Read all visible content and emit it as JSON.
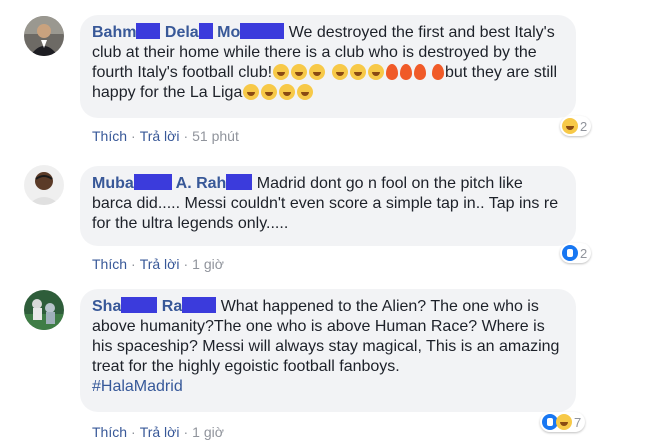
{
  "comments": [
    {
      "name_parts": [
        "Bahm",
        "Dela",
        "Mo"
      ],
      "text": "We destroyed the first and best Italy's club at their home while there is a club who is destroyed by the fourth Italy's football club!",
      "text_end": "but they are still happy for the La Liga",
      "actions": {
        "like": "Thích",
        "reply": "Trả lời",
        "time": "51 phút"
      },
      "reaction_count": "2",
      "reaction_icons": [
        "haha-icon"
      ]
    },
    {
      "name_parts": [
        "Muba",
        "A. Rah"
      ],
      "text": "Madrid dont go n fool on the pitch like barca did..... Messi couldn't even score a simple tap in.. Tap ins re for the ultra legends only.....",
      "actions": {
        "like": "Thích",
        "reply": "Trả lời",
        "time": "1 giờ"
      },
      "reaction_count": "2",
      "reaction_icons": [
        "like-icon"
      ]
    },
    {
      "name_parts": [
        "Sha",
        "Ra"
      ],
      "text": "What happened to the Alien? The one who is above humanity?The one who is above Human Race? Where is his spaceship? Messi will always stay magical, This is an amazing treat for the highly egoistic football fanboys.",
      "hashtag": "#HalaMadrid",
      "actions": {
        "like": "Thích",
        "reply": "Trả lời",
        "time": "1 giờ"
      },
      "reaction_count": "7",
      "reaction_icons": [
        "like-icon",
        "haha-icon"
      ]
    }
  ],
  "separator": "·",
  "colors": {
    "name": "#385898",
    "bubble": "#f2f3f5",
    "redaction": "#3b3bdc",
    "meta": "#90949c"
  }
}
